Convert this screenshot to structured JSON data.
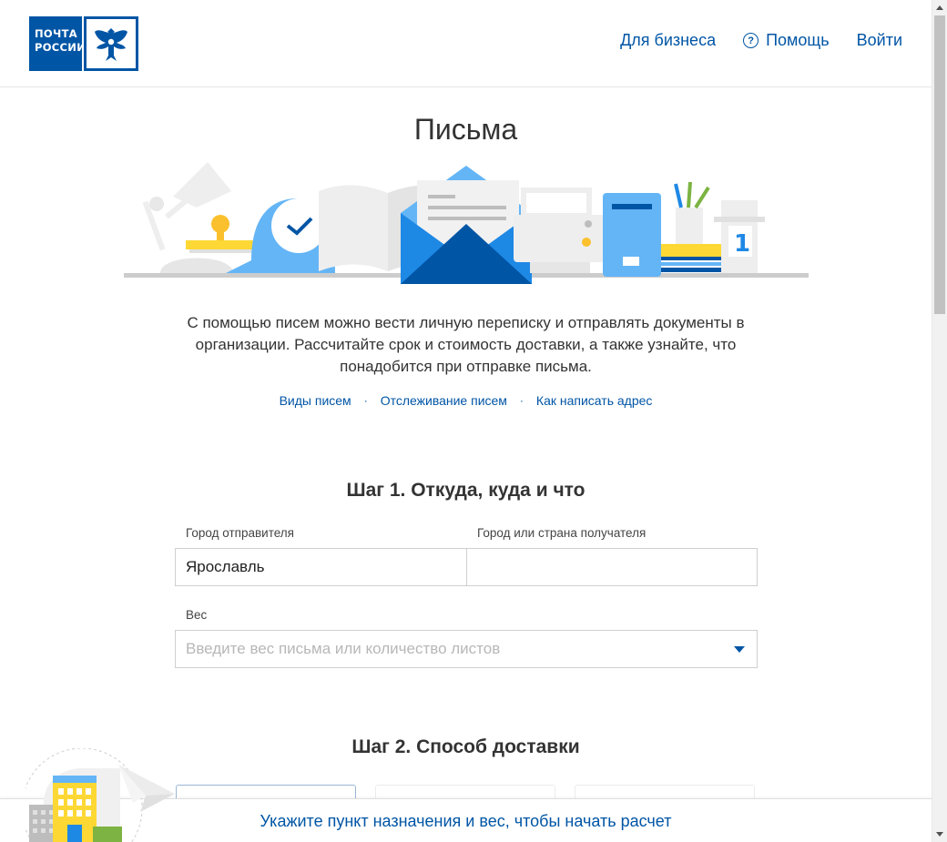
{
  "header": {
    "logo_line1": "ПОЧТА",
    "logo_line2": "РОССИИ",
    "nav": {
      "business": "Для бизнеса",
      "help": "Помощь",
      "login": "Войти"
    }
  },
  "page": {
    "title": "Письма",
    "description": "С помощью писем можно вести личную переписку и отправлять документы в организации. Рассчитайте срок и стоимость доставки, а также узнайте, что понадобится при отправке письма.",
    "links": [
      "Виды писем",
      "Отслеживание писем",
      "Как написать адрес"
    ],
    "link_separator": "·"
  },
  "step1": {
    "title": "Шаг 1. Откуда, куда и что",
    "sender_label": "Город отправителя",
    "sender_value": "Ярославль",
    "recipient_label": "Город или страна получателя",
    "recipient_value": "",
    "weight_label": "Вес",
    "weight_placeholder": "Введите вес письма или количество листов"
  },
  "step2": {
    "title": "Шаг 2. Способ доставки"
  },
  "bottom_bar": {
    "message": "Укажите пункт назначения и вес, чтобы начать расчет"
  },
  "icons": {
    "help": "question-circle-icon",
    "dropdown": "chevron-down-icon",
    "emblem": "eagle-emblem-icon"
  },
  "colors": {
    "brand": "#0055a5",
    "accent_light_blue": "#64b5f6",
    "accent_yellow": "#fdd835"
  }
}
